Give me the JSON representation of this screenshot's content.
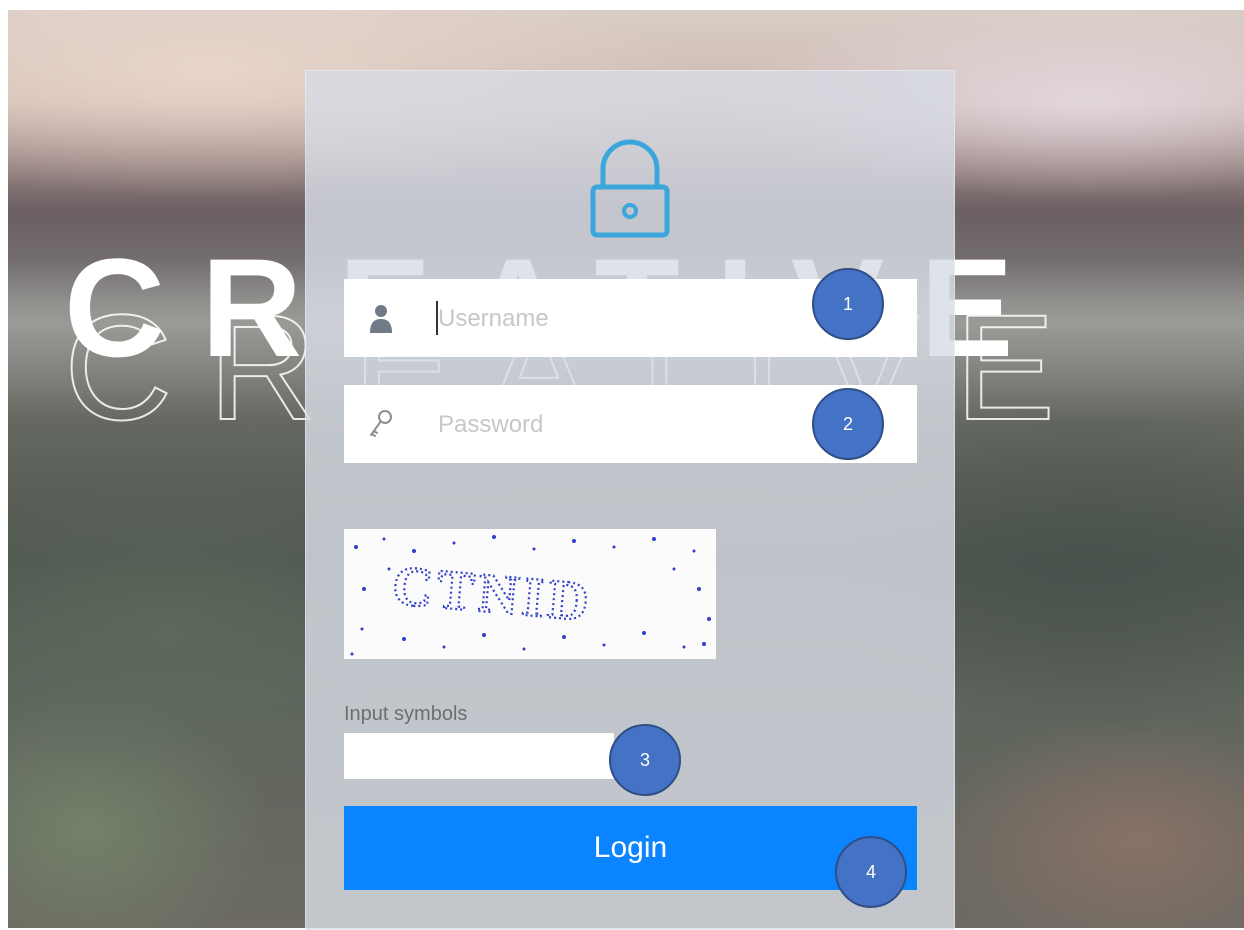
{
  "background": {
    "word": "CREATIVE"
  },
  "login": {
    "username_placeholder": "Username",
    "password_placeholder": "Password",
    "captcha_text": "CTNID",
    "symbols_label": "Input symbols",
    "login_label": "Login"
  },
  "markers": [
    "1",
    "2",
    "3",
    "4"
  ],
  "colors": {
    "accent": "#0a84ff",
    "lock_icon": "#3aa6dc",
    "marker": "#4472c4"
  },
  "icons": {
    "lock": "lock-icon",
    "user": "user-icon",
    "key": "key-icon"
  }
}
